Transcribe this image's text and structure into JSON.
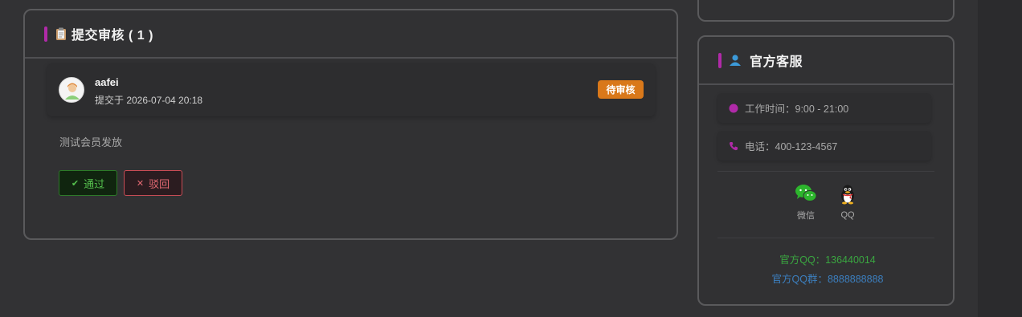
{
  "review": {
    "title": "提交审核 ( 1 )",
    "entry": {
      "username": "aafei",
      "submitted": "提交于 2026-07-04 20:18",
      "status": "待审核",
      "note": "测试会员发放"
    },
    "approve_label": "通过",
    "reject_label": "驳回"
  },
  "service": {
    "title": "官方客服",
    "hours": "工作时间：9:00 - 21:00",
    "phone": "电话：400-123-4567",
    "wechat_label": "微信",
    "qq_label": "QQ",
    "official_qq": "官方QQ：136440014",
    "official_qq_group": "官方QQ群：8888888888"
  },
  "colors": {
    "accent": "#b02aa8",
    "status_pending": "#d9781a",
    "approve": "#56c24e",
    "reject": "#e46a73",
    "qq_text": "#3aa640",
    "qq_group_text": "#3c7fbf"
  },
  "icons": {
    "review_title": "clipboard-icon",
    "service_title": "user-icon",
    "hours": "dot-icon",
    "phone": "phone-icon",
    "wechat": "wechat-icon",
    "qq": "qq-penguin-icon",
    "approve": "check-icon",
    "reject": "close-icon"
  }
}
